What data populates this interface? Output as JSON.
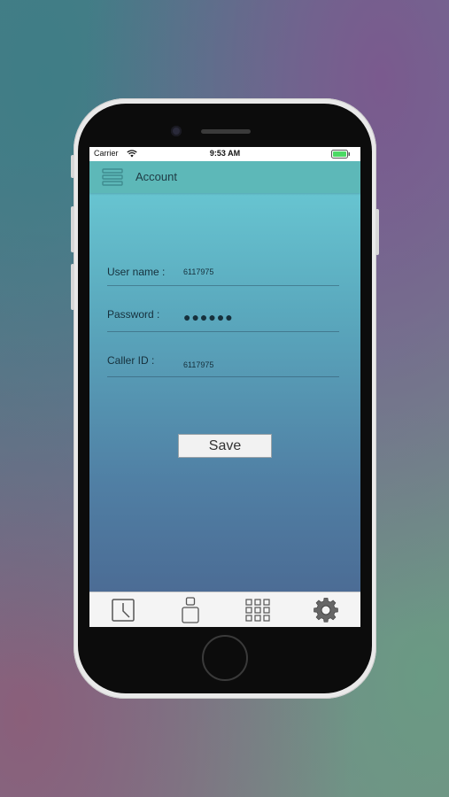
{
  "status_bar": {
    "carrier": "Carrier",
    "time": "9:53 AM",
    "battery_color": "#4cd964"
  },
  "nav": {
    "title": "Account",
    "menu_icon": "hamburger-menu-icon"
  },
  "form": {
    "username": {
      "label": "User name :",
      "value": "6117975"
    },
    "password": {
      "label": "Password :",
      "value": "●●●●●●"
    },
    "caller_id": {
      "label": "Caller ID :",
      "value": "6117975"
    }
  },
  "actions": {
    "save_label": "Save"
  },
  "tabs": [
    {
      "icon": "clock-icon"
    },
    {
      "icon": "contact-icon"
    },
    {
      "icon": "keypad-icon"
    },
    {
      "icon": "gear-icon",
      "selected": true
    }
  ],
  "colors": {
    "nav_bar": "#5db8b8",
    "screen_top": "#6ccfd8",
    "screen_bottom": "#4a6690",
    "tab_bar": "#f4f4f4"
  }
}
